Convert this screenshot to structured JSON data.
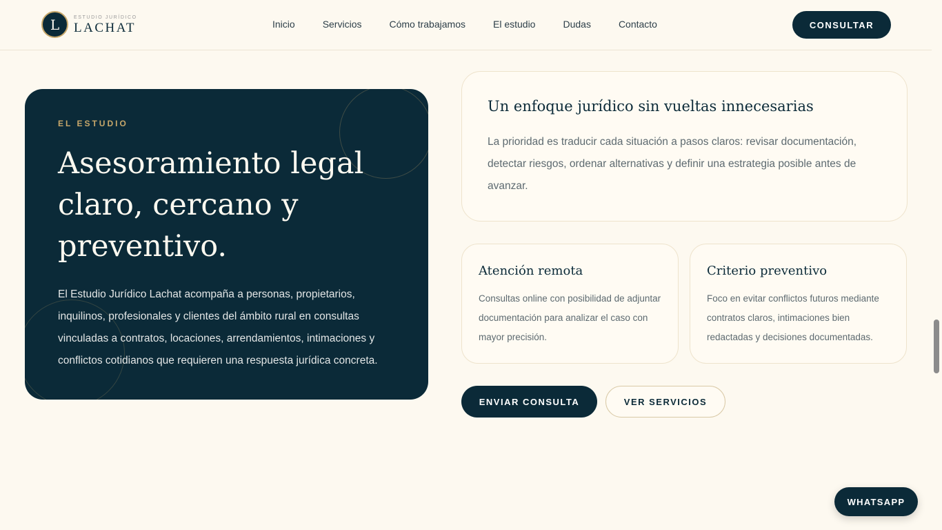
{
  "header": {
    "logo": {
      "mark": "L",
      "subtitle": "ESTUDIO JURÍDICO",
      "name": "LACHAT"
    },
    "nav": [
      "Inicio",
      "Servicios",
      "Cómo trabajamos",
      "El estudio",
      "Dudas",
      "Contacto"
    ],
    "cta": "CONSULTAR"
  },
  "hero": {
    "eyebrow": "EL ESTUDIO",
    "title": "Asesoramiento legal claro, cercano y preventivo.",
    "body": "El Estudio Jurídico Lachat acompaña a personas, propietarios, inquilinos, profesionales y clientes del ámbito rural en consultas vinculadas a contratos, locaciones, arrendamientos, intimaciones y conflictos cotidianos que requieren una respuesta jurídica concreta."
  },
  "main_card": {
    "title": "Un enfoque jurídico sin vueltas innecesarias",
    "body": "La prioridad es traducir cada situación a pasos claros: revisar documentación, detectar riesgos, ordenar alternativas y definir una estrategia posible antes de avanzar."
  },
  "cards": [
    {
      "title": "Atención remota",
      "body": "Consultas online con posibilidad de adjuntar documentación para analizar el caso con mayor precisión."
    },
    {
      "title": "Criterio preventivo",
      "body": "Foco en evitar conflictos futuros mediante contratos claros, intimaciones bien redactadas y decisiones documentadas."
    }
  ],
  "actions": {
    "primary": "ENVIAR CONSULTA",
    "secondary": "VER SERVICIOS"
  },
  "whatsapp": "WHATSAPP",
  "colors": {
    "navy": "#0b2a38",
    "gold": "#c7a76a",
    "background": "#fdf9f0"
  }
}
